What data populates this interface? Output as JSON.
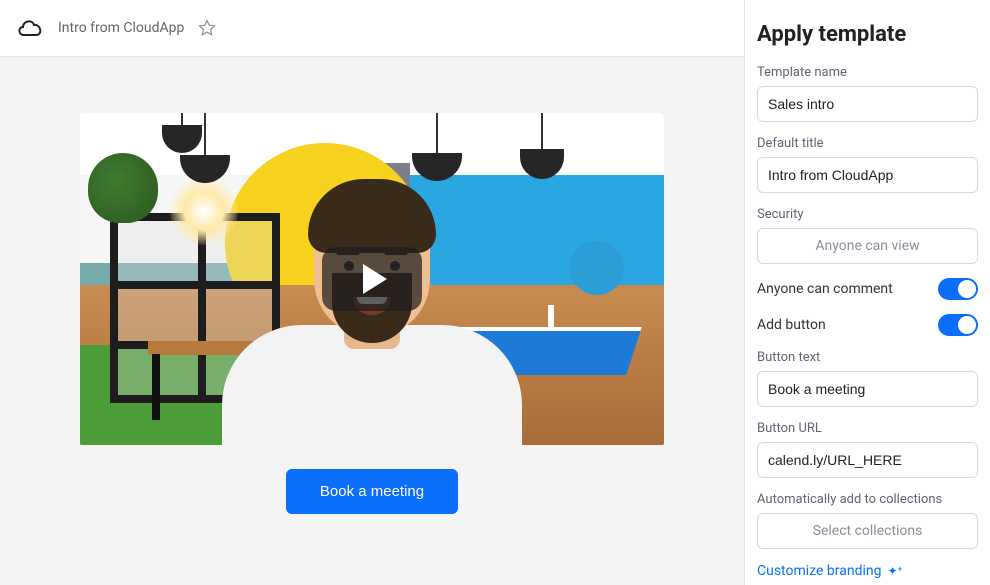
{
  "header": {
    "title": "Intro from CloudApp"
  },
  "preview": {
    "cta_label": "Book a meeting"
  },
  "sidebar": {
    "heading": "Apply template",
    "template_name": {
      "label": "Template name",
      "value": "Sales intro"
    },
    "default_title": {
      "label": "Default title",
      "value": "Intro from CloudApp"
    },
    "security": {
      "label": "Security",
      "placeholder": "Anyone can view"
    },
    "comment_toggle": {
      "label": "Anyone can comment",
      "on": true
    },
    "add_button_toggle": {
      "label": "Add button",
      "on": true
    },
    "button_text": {
      "label": "Button text",
      "value": "Book a meeting"
    },
    "button_url": {
      "label": "Button URL",
      "value": "calend.ly/URL_HERE"
    },
    "collections": {
      "label": "Automatically add to collections",
      "placeholder": "Select collections"
    },
    "branding_link": "Customize branding"
  }
}
